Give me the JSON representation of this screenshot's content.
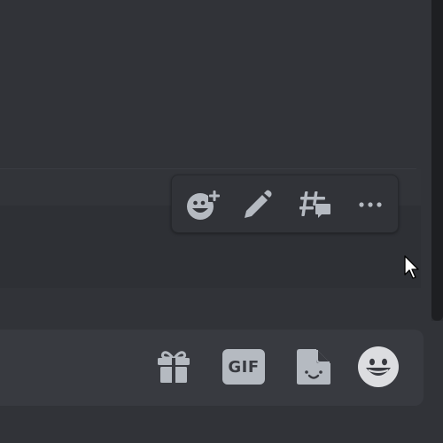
{
  "colors": {
    "background": "#313338",
    "icon": "#b5bac1",
    "toolbar": "#313338",
    "composer": "#383a40"
  },
  "hover_toolbar": {
    "buttons": [
      {
        "name": "add-reaction",
        "icon": "emoji-plus-icon"
      },
      {
        "name": "edit",
        "icon": "pencil-icon"
      },
      {
        "name": "create-thread",
        "icon": "thread-icon"
      },
      {
        "name": "more",
        "icon": "ellipsis-icon"
      }
    ]
  },
  "composer": {
    "buttons": [
      {
        "name": "gift",
        "icon": "gift-icon"
      },
      {
        "name": "gif",
        "icon": "gif-icon",
        "label": "GIF"
      },
      {
        "name": "sticker",
        "icon": "sticker-icon"
      },
      {
        "name": "emoji",
        "icon": "smiley-icon"
      }
    ]
  }
}
